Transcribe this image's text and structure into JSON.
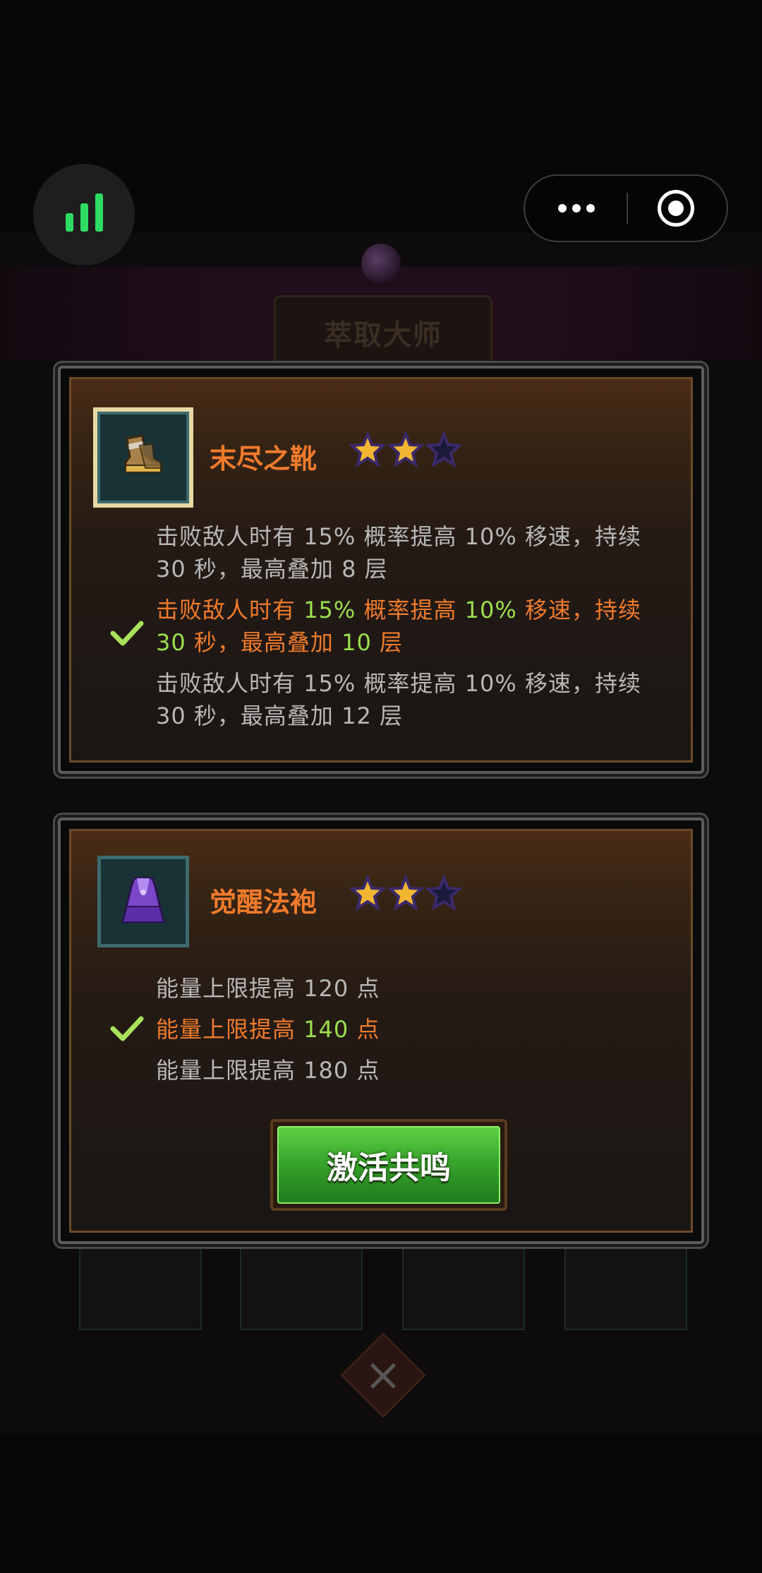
{
  "background": {
    "title": "萃取大师"
  },
  "capsule": {
    "more_icon": "more-dots-icon",
    "close_icon": "target-circle-icon"
  },
  "signal": {
    "icon": "signal-bars-icon",
    "color": "#2ddc63"
  },
  "items": [
    {
      "name": "末尽之靴",
      "icon": "boots-icon",
      "stars_filled": 2,
      "stars_total": 3,
      "effects": [
        {
          "prefix": "击败敌人时有 ",
          "chance": "15%",
          "mid": " 概率提高 ",
          "amount": "10%",
          "suffix": " 移速，持续",
          "line2_a": "",
          "duration": "30",
          "line2_b": " 秒，最高叠加 ",
          "stack": "8",
          "line2_c": " 层",
          "active": false
        },
        {
          "prefix": "击败敌人时有 ",
          "chance": "15%",
          "mid": " 概率提高 ",
          "amount": "10%",
          "suffix": " 移速，持续",
          "line2_a": "",
          "duration": "30",
          "line2_b": " 秒，最高叠加 ",
          "stack": "10",
          "line2_c": " 层",
          "active": true
        },
        {
          "prefix": "击败敌人时有 ",
          "chance": "15%",
          "mid": " 概率提高 ",
          "amount": "10%",
          "suffix": " 移速，持续",
          "line2_a": "",
          "duration": "30",
          "line2_b": " 秒，最高叠加 ",
          "stack": "12",
          "line2_c": " 层",
          "active": false
        }
      ]
    },
    {
      "name": "觉醒法袍",
      "icon": "robe-icon",
      "stars_filled": 2,
      "stars_total": 3,
      "effects": [
        {
          "prefix": "能量上限提高 ",
          "value": "120",
          "suffix": " 点",
          "active": false
        },
        {
          "prefix": "能量上限提高 ",
          "value": "140",
          "suffix": " 点",
          "active": true
        },
        {
          "prefix": "能量上限提高 ",
          "value": "180",
          "suffix": " 点",
          "active": false
        }
      ]
    }
  ],
  "activate_button": {
    "label": "激活共鸣"
  },
  "colors": {
    "accent_orange": "#f07b2c",
    "highlight_green": "#9ce04d",
    "button_green": "#38a62c"
  }
}
